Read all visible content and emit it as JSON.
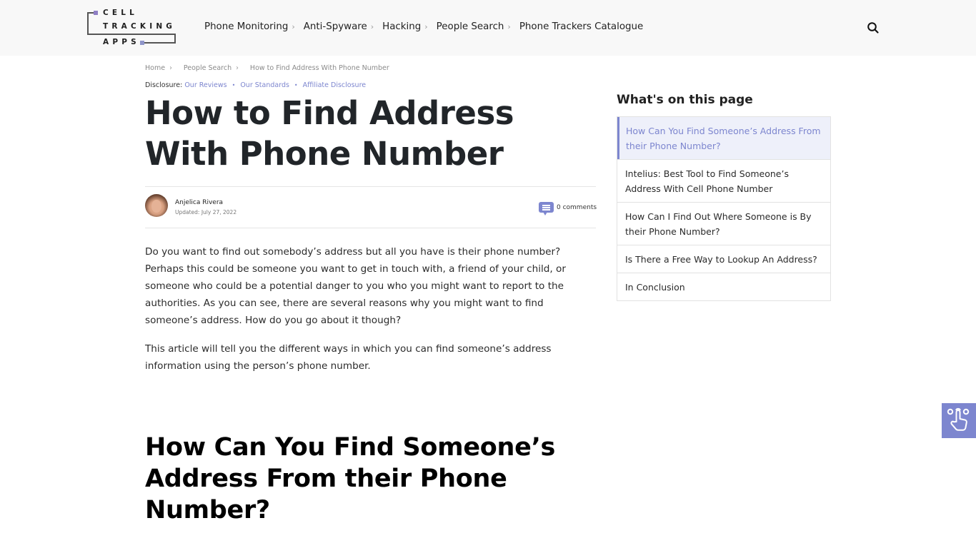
{
  "header": {
    "logo": {
      "line1": "CELL",
      "line2": "TRACKING",
      "line3": "APPS"
    },
    "nav": [
      {
        "label": "Phone Monitoring",
        "has_chevron": true
      },
      {
        "label": "Anti-Spyware",
        "has_chevron": true
      },
      {
        "label": "Hacking",
        "has_chevron": true
      },
      {
        "label": "People Search",
        "has_chevron": true
      },
      {
        "label": "Phone Trackers Catalogue",
        "has_chevron": false
      }
    ],
    "chevron": "›",
    "search_icon": "search-icon"
  },
  "breadcrumb": {
    "items": [
      "Home",
      "People Search",
      "How to Find Address With Phone Number"
    ],
    "separator": "›"
  },
  "disclosure": {
    "label": "Disclosure:",
    "links": [
      "Our Reviews",
      "Our Standards",
      "Affiliate Disclosure"
    ],
    "dot": "•"
  },
  "article": {
    "title": "How to Find Address With Phone Number",
    "author": "Anjelica Rivera",
    "updated": "Updated: July 27, 2022",
    "comments": "0 comments",
    "paragraphs": [
      "Do you want to find out somebody’s address but all you have is their phone number? Perhaps this could be someone you want to get in touch with, a friend of your child, or someone who could be a potential danger to you who you might want to report to the authorities. As you can see, there are several reasons why you might want to find someone’s address. How do you go about it though?",
      "This article will tell you the different ways in which you can find someone’s address information using the person’s phone number."
    ],
    "h2": "How Can You Find Someone’s Address From their Phone Number?"
  },
  "toc": {
    "title": "What's on this page",
    "items": [
      {
        "label": "How Can You Find Someone’s Address From their Phone Number?",
        "active": true
      },
      {
        "label": "Intelius: Best Tool to Find Someone’s Address With Cell Phone Number",
        "active": false
      },
      {
        "label": "How Can I Find Out Where Someone is By their Phone Number?",
        "active": false
      },
      {
        "label": "Is There a Free Way to Lookup An Address?",
        "active": false
      },
      {
        "label": "In Conclusion",
        "active": false
      }
    ]
  },
  "colors": {
    "accent": "#7d86cf",
    "toc_active_bg": "#eef0fa",
    "header_bg": "#f8f8f8",
    "logo_square": "#8f7fc4"
  },
  "accessibility_button": {
    "icon": "hand-touch-icon"
  }
}
